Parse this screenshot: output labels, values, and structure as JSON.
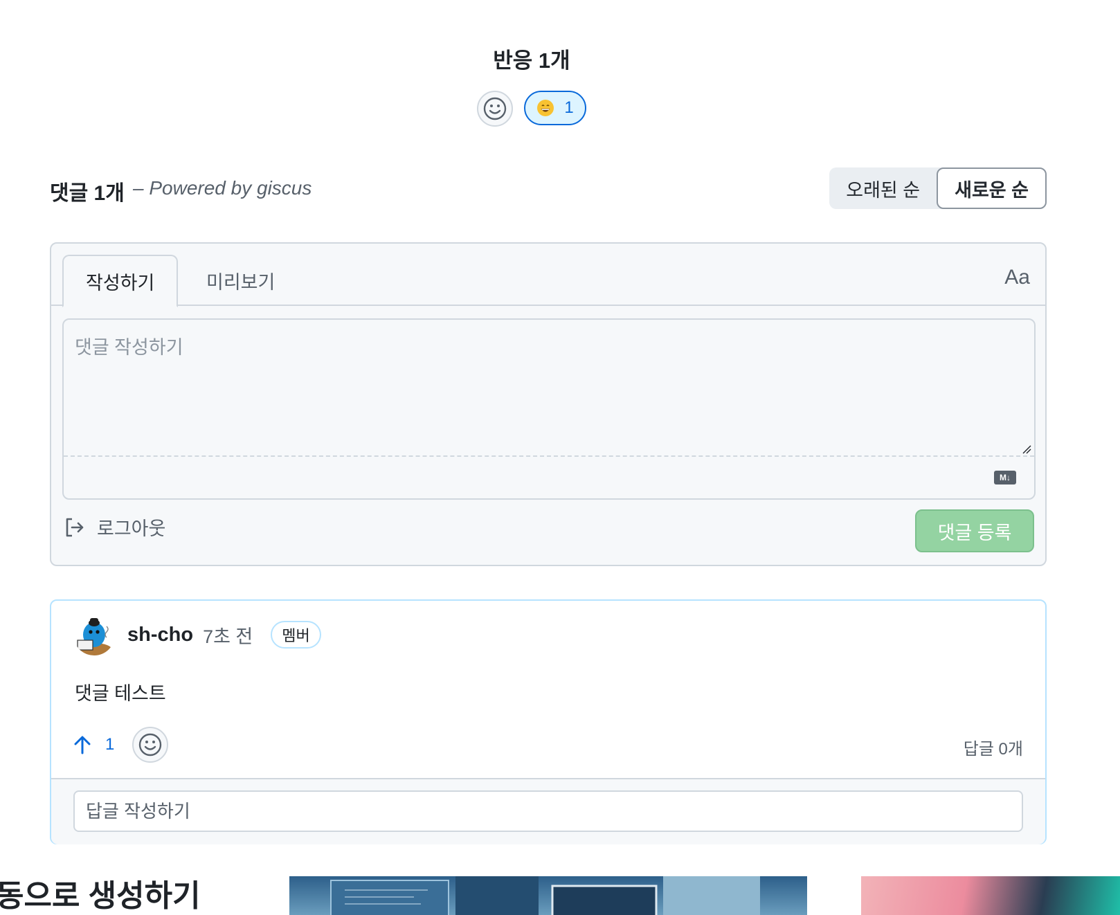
{
  "reactions": {
    "title": "반응 1개",
    "add_icon": "smiley-icon",
    "items": [
      {
        "emoji_icon": "grinning-face-icon",
        "count": "1"
      }
    ]
  },
  "comments_header": {
    "count": "댓글 1개",
    "powered_by": "– Powered by giscus",
    "sort_options": [
      "오래된 순",
      "새로운 순"
    ],
    "active_sort": "새로운 순"
  },
  "composer": {
    "tabs": [
      "작성하기",
      "미리보기"
    ],
    "active_tab": "작성하기",
    "font_toggle": "Aa",
    "placeholder": "댓글 작성하기",
    "value": "",
    "markdown_icon": "markdown-icon",
    "md_label": "M↓",
    "logout_label": "로그아웃",
    "submit_label": "댓글 등록"
  },
  "comment": {
    "author": "sh-cho",
    "time": "7초 전",
    "badge": "멤버",
    "body": "댓글 테스트",
    "upvotes": "1",
    "replies": "답글 0개",
    "reply_placeholder": "답글 작성하기"
  },
  "related": {
    "title": "동으로 생성하기"
  },
  "colors": {
    "accent": "#0969da",
    "submit_disabled": "#94d3a2",
    "border": "#d0d7de",
    "comment_border": "#b6e3ff"
  }
}
